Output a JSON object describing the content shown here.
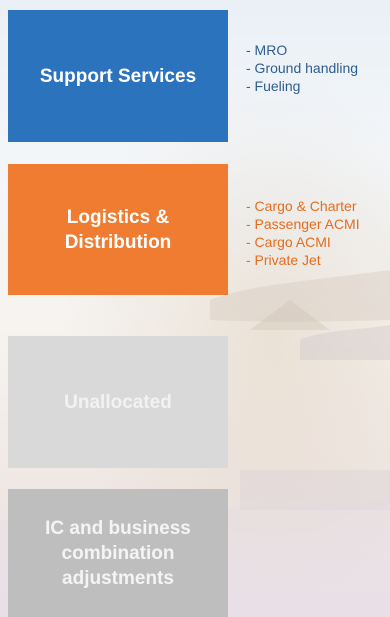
{
  "boxes": {
    "support_services": "Support Services",
    "logistics_line1": "Logistics &",
    "logistics_line2": "Distribution",
    "unallocated": "Unallocated",
    "ic_line1": "IC and business",
    "ic_line2": "combination",
    "ic_line3": "adjustments"
  },
  "support_items": [
    "- MRO",
    "- Ground handling",
    "- Fueling"
  ],
  "logistics_items": [
    "- Cargo & Charter",
    "- Passenger ACMI",
    "- Cargo ACMI",
    "- Private Jet"
  ],
  "colors": {
    "support": "#2b73bd",
    "logistics": "#ef7c31",
    "unallocated": "#d9d9d9",
    "ic": "#bebebe",
    "support_text": "#2f5e8e",
    "logistics_text": "#e46d1f"
  }
}
